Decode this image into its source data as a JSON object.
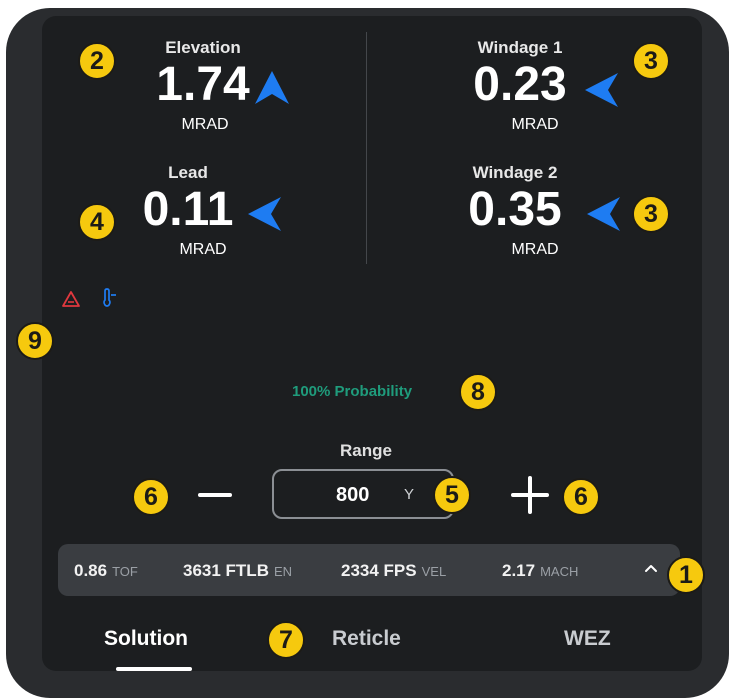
{
  "outputs": {
    "elevation": {
      "label": "Elevation",
      "value": "1.74",
      "unit": "MRAD"
    },
    "windage1": {
      "label": "Windage 1",
      "value": "0.23",
      "unit": "MRAD"
    },
    "lead": {
      "label": "Lead",
      "value": "0.11",
      "unit": "MRAD"
    },
    "windage2": {
      "label": "Windage 2",
      "value": "0.35",
      "unit": "MRAD"
    }
  },
  "badges": {
    "b1": "1",
    "b2": "2",
    "b3": "3",
    "b4": "4",
    "b5": "5",
    "b6": "6",
    "b7": "7",
    "b8": "8",
    "b9": "9"
  },
  "status_icons": [
    "warning-triangle-icon",
    "thermometer-icon"
  ],
  "probability": "100% Probability",
  "range": {
    "label": "Range",
    "value": "800",
    "unit": "Y"
  },
  "stats": [
    {
      "value": "0.86",
      "key": "TOF"
    },
    {
      "value": "3631 FTLB",
      "key": "EN"
    },
    {
      "value": "2334 FPS",
      "key": "VEL"
    },
    {
      "value": "2.17",
      "key": "MACH"
    }
  ],
  "tabs": {
    "solution": "Solution",
    "reticle": "Reticle",
    "wez": "WEZ",
    "active": "Solution"
  },
  "colors": {
    "accent": "#1e7cf2",
    "badge": "#f6c90e",
    "probability": "#1f9c7c",
    "warning": "#e0383e"
  }
}
